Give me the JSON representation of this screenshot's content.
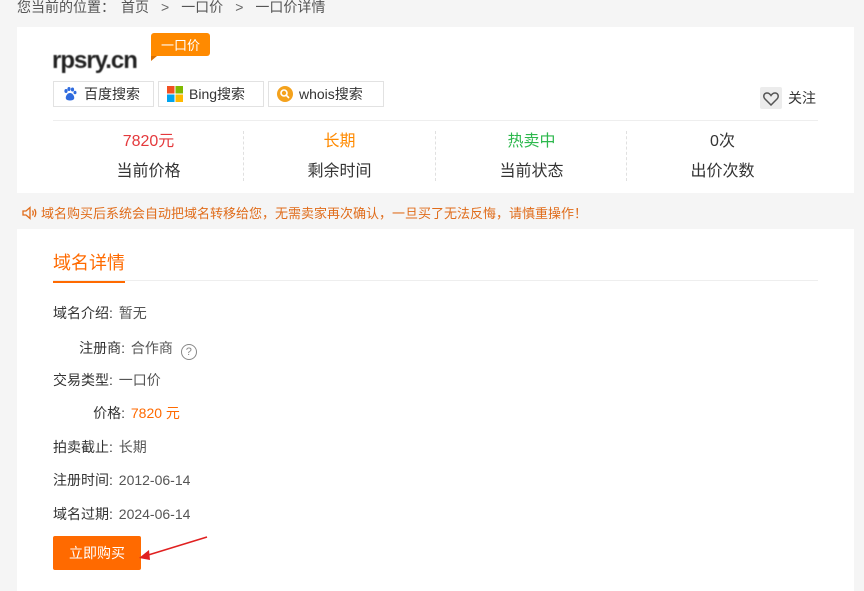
{
  "breadcrumb": {
    "prefix": "您当前的位置：",
    "items": [
      "首页",
      "一口价",
      "一口价详情"
    ]
  },
  "domain": {
    "name": "rpsry.cn",
    "tag": "一口价"
  },
  "search_buttons": [
    {
      "label": "百度搜索",
      "icon": "baidu-icon"
    },
    {
      "label": "Bing搜索",
      "icon": "bing-icon"
    },
    {
      "label": "whois搜索",
      "icon": "whois-icon"
    }
  ],
  "follow": {
    "label": "关注",
    "icon": "heart-icon"
  },
  "stats": [
    {
      "value": "7820元",
      "label": "当前价格",
      "color": "#e4393c"
    },
    {
      "value": "长期",
      "label": "剩余时间",
      "color": "#ff8a00"
    },
    {
      "value": "热卖中",
      "label": "当前状态",
      "color": "#2db84d"
    },
    {
      "value": "0次",
      "label": "出价次数",
      "color": "#333333"
    }
  ],
  "notice": "域名购买后系统会自动把域名转移给您，无需卖家再次确认，一旦买了无法反悔，请慎重操作！",
  "details": {
    "title": "域名详情",
    "rows": {
      "intro": {
        "key": "域名介绍:",
        "value": "暂无"
      },
      "registrar": {
        "key": "注册商:",
        "value": "合作商"
      },
      "type": {
        "key": "交易类型:",
        "value": "一口价"
      },
      "price": {
        "key": "价格:",
        "value": "7820 元"
      },
      "deadline": {
        "key": "拍卖截止:",
        "value": "长期"
      },
      "reg_date": {
        "key": "注册时间:",
        "value": "2012-06-14"
      },
      "expire": {
        "key": "域名过期:",
        "value": "2024-06-14"
      }
    },
    "buy_label": "立即购买"
  },
  "colors": {
    "accent": "#ff6a00",
    "price_red": "#e4393c",
    "status_green": "#2db84d"
  }
}
